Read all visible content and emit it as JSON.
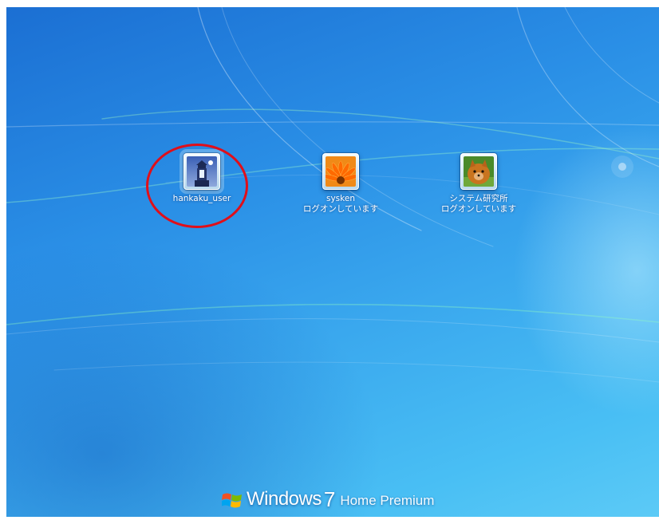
{
  "users": [
    {
      "name": "hankaku_user",
      "status": "",
      "picture": "lighthouse-picture",
      "selected": true
    },
    {
      "name": "sysken",
      "status": "ログオンしています",
      "picture": "orange-flower-picture",
      "selected": false
    },
    {
      "name": "システム研究所",
      "status": "ログオンしています",
      "picture": "pomeranian-dog-picture",
      "selected": false
    }
  ],
  "branding": {
    "logo": "windows-flag-icon",
    "product": "Windows",
    "version": "7",
    "edition": "Home Premium"
  },
  "colors": {
    "background": "#2a8fe6",
    "highlight_ring": "#e00f1a"
  }
}
